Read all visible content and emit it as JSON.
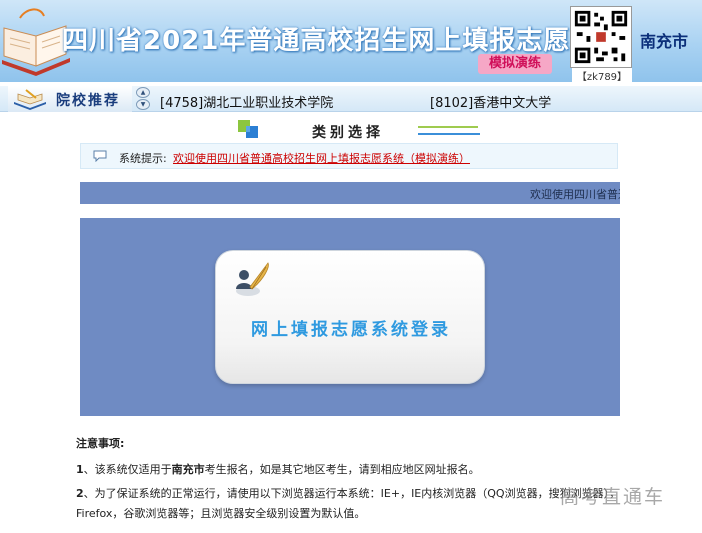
{
  "header": {
    "title": "四川省2021年普通高校招生网上填报志愿",
    "mock_label": "模拟演练",
    "qr_code_label": "【zk789】",
    "city": "南充市"
  },
  "navbar": {
    "label": "院校推荐",
    "school_1": "[4758]湖北工业职业技术学院",
    "school_2": "[8102]香港中文大学"
  },
  "category": {
    "title": "类别选择"
  },
  "tip": {
    "label": "系统提示:",
    "message": "欢迎使用四川省普通高校招生网上填报志愿系统（模拟演练）"
  },
  "marquee": {
    "text": "欢迎使用四川省普通"
  },
  "login": {
    "button_label": "网上填报志愿系统登录"
  },
  "notes": {
    "title": "注意事项:",
    "item1_num": "1",
    "item1_pre": "、该系统仅适用于",
    "item1_city": "南充市",
    "item1_post": "考生报名，如是其它地区考生，请到相应地区网址报名。",
    "item2_num": "2",
    "item2_line1": "、为了保证系统的正常运行，请使用以下浏览器运行本系统：IE+，IE内核浏览器（QQ浏览器，搜狗浏览器），",
    "item2_line2": "Firefox，谷歌浏览器等；且浏览器安全级别设置为默认值。"
  },
  "watermark": "高考直通车",
  "colors": {
    "header_blue": "#a9d2f2",
    "panel_blue": "#6f8bc3",
    "tip_red": "#cc0000",
    "login_text": "#2f9ae0"
  }
}
